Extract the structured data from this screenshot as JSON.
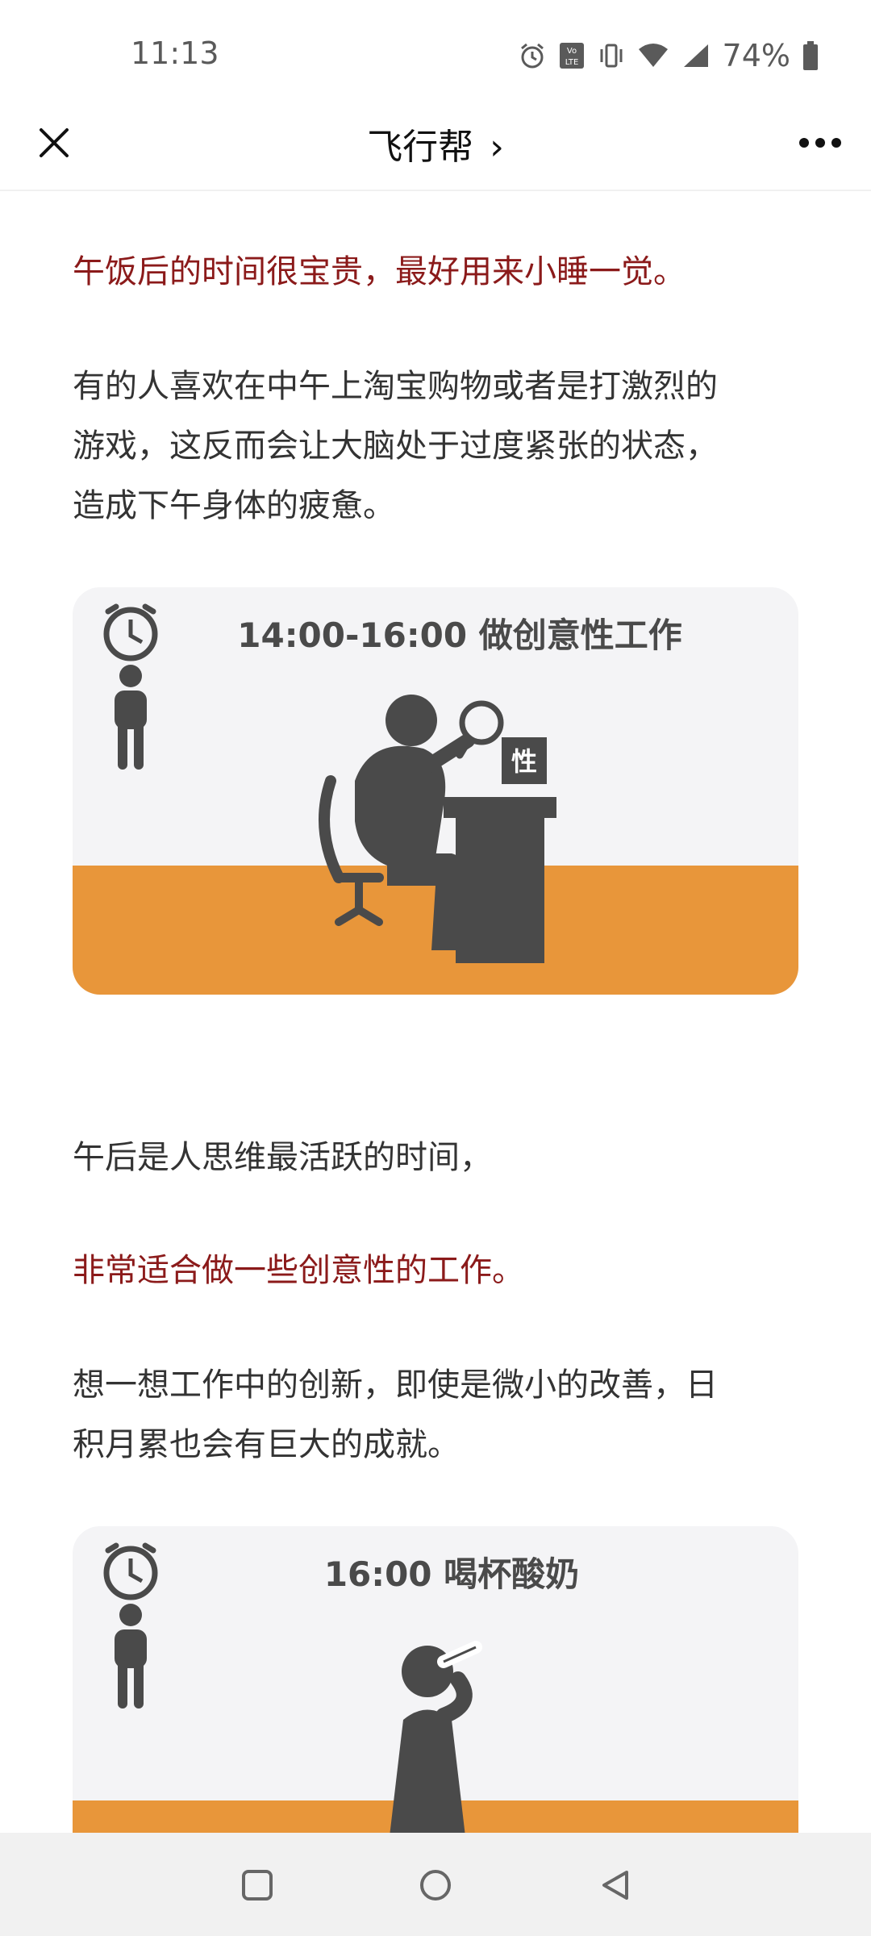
{
  "status_bar": {
    "time": "11:13",
    "battery": "74%",
    "icons": [
      "alarm-icon",
      "volte-icon",
      "vibrate-icon",
      "wifi-icon",
      "signal-icon",
      "battery-icon"
    ]
  },
  "nav": {
    "title": "飞行帮",
    "title_chevron": "›",
    "left_icon": "close-icon",
    "right_icon": "more-icon"
  },
  "article": {
    "p1": "午饭后的时间很宝贵，最好用来小睡一觉。",
    "p2_lines": [
      "有的人喜欢在中午上淘宝购物或者是打激烈的",
      "游戏，这反而会让大脑处于过度紧张的状态，",
      "造成下午身体的疲惫。"
    ],
    "card1": {
      "title": "14:00-16:00 做创意性工作",
      "tag": "性"
    },
    "p3": "午后是人思维最活跃的时间，",
    "p4": "非常适合做一些创意性的工作。",
    "p5_lines": [
      "想一想工作中的创新，即使是微小的改善，日",
      "积月累也会有巨大的成就。"
    ],
    "card2": {
      "title": "16:00 喝杯酸奶"
    }
  },
  "colors": {
    "accent_red": "#8b1a1a",
    "band_orange": "#e8963a",
    "figure_gray": "#4a4a4a"
  },
  "system_nav": {
    "icons": [
      "recent-apps-icon",
      "home-icon",
      "back-icon"
    ]
  }
}
